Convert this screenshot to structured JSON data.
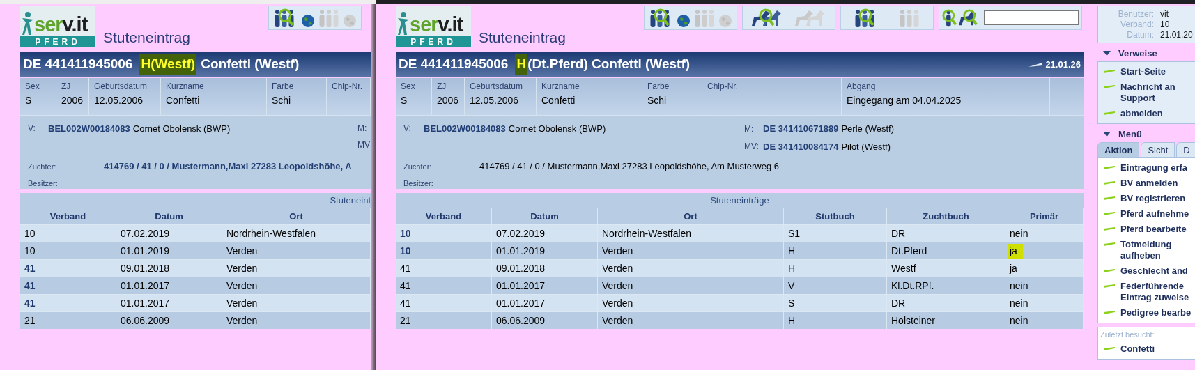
{
  "windows": [
    {
      "focused": false,
      "logo": {
        "text": [
          "ser",
          "v.it"
        ],
        "sub": "PFERD"
      },
      "page_title": "Stuteneintrag",
      "toolbar": [
        {
          "kind": "people"
        }
      ],
      "header": {
        "id": "DE 441411945006",
        "marked": "H(Westf)",
        "spaced": true,
        "rest": "Confetti (Westf)"
      },
      "fields": [
        {
          "label": "Sex",
          "value": "S"
        },
        {
          "label": "ZJ",
          "value": "2006"
        },
        {
          "label": "Geburtsdatum",
          "value": "12.05.2006"
        },
        {
          "label": "Kurzname",
          "value": "Confetti"
        },
        {
          "label": "Farbe",
          "value": "Schi"
        },
        {
          "label": "Chip-Nr."
        }
      ],
      "sire": {
        "label": "V:",
        "id": "BEL002W00184083",
        "name": "Cornet Obolensk (BWP)"
      },
      "dam_lines": [
        {
          "label": "M:"
        },
        {
          "label": "MV"
        }
      ],
      "owners": [
        {
          "label": "Züchter:",
          "value": "414769 / 41 / 0 / Mustermann,Maxi 27283 Leopoldshöhe, A",
          "emphasized": true
        },
        {
          "label": "Besitzer:"
        }
      ],
      "table": {
        "caption": "Stuteneint",
        "caption_cut": true,
        "columns": [
          "Verband",
          "Datum",
          "Ort"
        ],
        "rows": [
          {
            "link": false,
            "cells": [
              "10",
              "07.02.2019",
              "Nordrhein-Westfalen"
            ]
          },
          {
            "link": false,
            "cells": [
              "10",
              "01.01.2019",
              "Verden"
            ]
          },
          {
            "link": true,
            "cells": [
              "41",
              "09.01.2018",
              "Verden"
            ]
          },
          {
            "link": true,
            "cells": [
              "41",
              "01.01.2017",
              "Verden"
            ]
          },
          {
            "link": true,
            "cells": [
              "41",
              "01.01.2017",
              "Verden"
            ]
          },
          {
            "link": false,
            "cells": [
              "21",
              "06.06.2009",
              "Verden"
            ]
          }
        ]
      }
    },
    {
      "focused": true,
      "logo": {
        "text": [
          "ser",
          "v.it"
        ],
        "sub": "PFERD"
      },
      "page_title": "Stuteneintrag",
      "toolbar": [
        {
          "kind": "people"
        },
        {
          "kind": "horses"
        },
        {
          "kind": "persons"
        },
        {
          "kind": "mixed"
        }
      ],
      "header": {
        "id": "DE 441411945006",
        "marked": "H",
        "spaced": false,
        "rest": "(Dt.Pferd) Confetti (Westf)",
        "date": "21.01.26"
      },
      "fields": [
        {
          "label": "Sex",
          "value": "S"
        },
        {
          "label": "ZJ",
          "value": "2006"
        },
        {
          "label": "Geburtsdatum",
          "value": "12.05.2006"
        },
        {
          "label": "Kurzname",
          "value": "Confetti"
        },
        {
          "label": "Farbe",
          "value": "Schi"
        },
        {
          "label": "Chip-Nr."
        },
        {
          "label": "Abgang",
          "value": "Eingegang am 04.04.2025"
        }
      ],
      "sire": {
        "label": "V:",
        "id": "BEL002W00184083",
        "name": "Cornet Obolensk (BWP)"
      },
      "dam_lines": [
        {
          "label": "M:",
          "id": "DE 341410671889",
          "name": "Perle (Westf)"
        },
        {
          "label": "MV:",
          "id": "DE 341410084174",
          "name": "Pilot (Westf)"
        }
      ],
      "owners": [
        {
          "label": "Züchter:",
          "value": "414769 / 41 / 0 / Mustermann,Maxi 27283 Leopoldshöhe, Am Musterweg 6",
          "emphasized": false
        },
        {
          "label": "Besitzer:"
        }
      ],
      "table": {
        "caption": "Stuteneinträge",
        "caption_cut": false,
        "columns": [
          "Verband",
          "Datum",
          "Ort",
          "Stutbuch",
          "Zuchtbuch",
          "Primär"
        ],
        "rows": [
          {
            "link": true,
            "marked": false,
            "cells": [
              "10",
              "07.02.2019",
              "Nordrhein-Westfalen",
              "S1",
              "DR",
              "nein"
            ]
          },
          {
            "link": true,
            "marked": true,
            "cells": [
              "10",
              "01.01.2019",
              "Verden",
              "H",
              "Dt.Pferd",
              "ja"
            ]
          },
          {
            "link": false,
            "marked": false,
            "cells": [
              "41",
              "09.01.2018",
              "Verden",
              "H",
              "Westf",
              "ja"
            ]
          },
          {
            "link": false,
            "marked": false,
            "cells": [
              "41",
              "01.01.2017",
              "Verden",
              "V",
              "Kl.Dt.RPf.",
              "nein"
            ]
          },
          {
            "link": false,
            "marked": false,
            "cells": [
              "41",
              "01.01.2017",
              "Verden",
              "S",
              "DR",
              "nein"
            ]
          },
          {
            "link": false,
            "marked": false,
            "cells": [
              "21",
              "06.06.2009",
              "Verden",
              "H",
              "Holsteiner",
              "nein"
            ]
          }
        ]
      }
    }
  ],
  "sidebar": {
    "user": [
      {
        "label": "Benutzer:",
        "value": "vit"
      },
      {
        "label": "Verband:",
        "value": "10"
      },
      {
        "label": "Datum:",
        "value": "21.01.20"
      }
    ],
    "sections": [
      {
        "title": "Verweise",
        "expanded": true,
        "links": [
          {
            "lines": [
              "Start-Seite"
            ]
          },
          {
            "lines": [
              "Nachricht an",
              "Support"
            ]
          },
          {
            "lines": [
              "abmelden"
            ]
          }
        ]
      },
      {
        "title": "Menü",
        "expanded": true,
        "tabs": [
          {
            "label": "Aktion",
            "selected": true
          },
          {
            "label": "Sicht",
            "selected": false
          },
          {
            "label": "D",
            "selected": false
          }
        ],
        "links": [
          {
            "lines": [
              "Eintragung erfa"
            ]
          },
          {
            "lines": [
              "BV anmelden"
            ]
          },
          {
            "lines": [
              "BV registrieren"
            ]
          },
          {
            "lines": [
              "Pferd aufnehme"
            ]
          },
          {
            "lines": [
              "Pferd bearbeite"
            ]
          },
          {
            "lines": [
              "Totmeldung",
              "aufheben"
            ]
          },
          {
            "lines": [
              "Geschlecht änd"
            ]
          },
          {
            "lines": [
              "Federführende",
              "Eintrag zuweise"
            ]
          },
          {
            "lines": [
              "Pedigree bearbe"
            ]
          }
        ]
      }
    ],
    "recent": {
      "title": "Zuletzt besucht:",
      "links": [
        {
          "lines": [
            "Confetti"
          ]
        }
      ]
    }
  }
}
